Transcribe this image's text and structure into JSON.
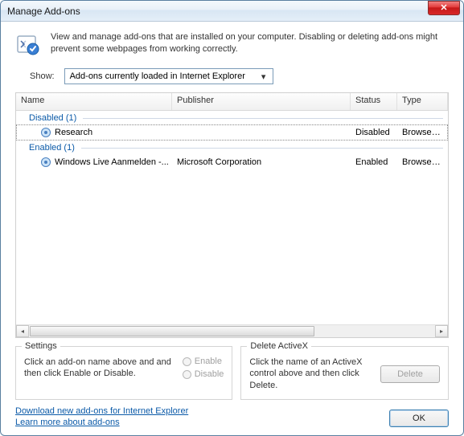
{
  "window": {
    "title": "Manage Add-ons"
  },
  "header": {
    "text": "View and manage add-ons that are installed on your computer. Disabling or deleting add-ons might prevent some webpages from working correctly."
  },
  "show": {
    "label": "Show:",
    "selected": "Add-ons currently loaded in Internet Explorer"
  },
  "columns": {
    "name": "Name",
    "publisher": "Publisher",
    "status": "Status",
    "type": "Type"
  },
  "groups": [
    {
      "label": "Disabled (1)",
      "rows": [
        {
          "name": "Research",
          "publisher": "",
          "status": "Disabled",
          "type": "Browser Ex"
        }
      ]
    },
    {
      "label": "Enabled (1)",
      "rows": [
        {
          "name": "Windows Live Aanmelden -...",
          "publisher": "Microsoft Corporation",
          "status": "Enabled",
          "type": "Browser H"
        }
      ]
    }
  ],
  "settings": {
    "title": "Settings",
    "desc": "Click an add-on name above and and then click Enable or Disable.",
    "enable": "Enable",
    "disable": "Disable"
  },
  "deletex": {
    "title": "Delete ActiveX",
    "desc": "Click the name of an ActiveX control above and then click Delete.",
    "button": "Delete"
  },
  "links": {
    "download": "Download new add-ons for Internet Explorer",
    "learn": "Learn more about add-ons"
  },
  "ok": "OK"
}
